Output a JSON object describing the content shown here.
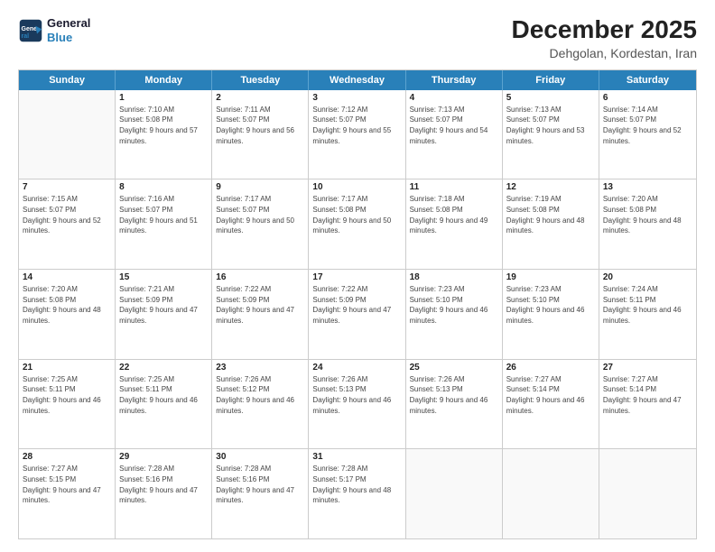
{
  "logo": {
    "line1": "General",
    "line2": "Blue"
  },
  "title": "December 2025",
  "location": "Dehgolan, Kordestan, Iran",
  "weekdays": [
    "Sunday",
    "Monday",
    "Tuesday",
    "Wednesday",
    "Thursday",
    "Friday",
    "Saturday"
  ],
  "rows": [
    [
      {
        "day": "",
        "sunrise": "",
        "sunset": "",
        "daylight": ""
      },
      {
        "day": "1",
        "sunrise": "Sunrise: 7:10 AM",
        "sunset": "Sunset: 5:08 PM",
        "daylight": "Daylight: 9 hours and 57 minutes."
      },
      {
        "day": "2",
        "sunrise": "Sunrise: 7:11 AM",
        "sunset": "Sunset: 5:07 PM",
        "daylight": "Daylight: 9 hours and 56 minutes."
      },
      {
        "day": "3",
        "sunrise": "Sunrise: 7:12 AM",
        "sunset": "Sunset: 5:07 PM",
        "daylight": "Daylight: 9 hours and 55 minutes."
      },
      {
        "day": "4",
        "sunrise": "Sunrise: 7:13 AM",
        "sunset": "Sunset: 5:07 PM",
        "daylight": "Daylight: 9 hours and 54 minutes."
      },
      {
        "day": "5",
        "sunrise": "Sunrise: 7:13 AM",
        "sunset": "Sunset: 5:07 PM",
        "daylight": "Daylight: 9 hours and 53 minutes."
      },
      {
        "day": "6",
        "sunrise": "Sunrise: 7:14 AM",
        "sunset": "Sunset: 5:07 PM",
        "daylight": "Daylight: 9 hours and 52 minutes."
      }
    ],
    [
      {
        "day": "7",
        "sunrise": "Sunrise: 7:15 AM",
        "sunset": "Sunset: 5:07 PM",
        "daylight": "Daylight: 9 hours and 52 minutes."
      },
      {
        "day": "8",
        "sunrise": "Sunrise: 7:16 AM",
        "sunset": "Sunset: 5:07 PM",
        "daylight": "Daylight: 9 hours and 51 minutes."
      },
      {
        "day": "9",
        "sunrise": "Sunrise: 7:17 AM",
        "sunset": "Sunset: 5:07 PM",
        "daylight": "Daylight: 9 hours and 50 minutes."
      },
      {
        "day": "10",
        "sunrise": "Sunrise: 7:17 AM",
        "sunset": "Sunset: 5:08 PM",
        "daylight": "Daylight: 9 hours and 50 minutes."
      },
      {
        "day": "11",
        "sunrise": "Sunrise: 7:18 AM",
        "sunset": "Sunset: 5:08 PM",
        "daylight": "Daylight: 9 hours and 49 minutes."
      },
      {
        "day": "12",
        "sunrise": "Sunrise: 7:19 AM",
        "sunset": "Sunset: 5:08 PM",
        "daylight": "Daylight: 9 hours and 48 minutes."
      },
      {
        "day": "13",
        "sunrise": "Sunrise: 7:20 AM",
        "sunset": "Sunset: 5:08 PM",
        "daylight": "Daylight: 9 hours and 48 minutes."
      }
    ],
    [
      {
        "day": "14",
        "sunrise": "Sunrise: 7:20 AM",
        "sunset": "Sunset: 5:08 PM",
        "daylight": "Daylight: 9 hours and 48 minutes."
      },
      {
        "day": "15",
        "sunrise": "Sunrise: 7:21 AM",
        "sunset": "Sunset: 5:09 PM",
        "daylight": "Daylight: 9 hours and 47 minutes."
      },
      {
        "day": "16",
        "sunrise": "Sunrise: 7:22 AM",
        "sunset": "Sunset: 5:09 PM",
        "daylight": "Daylight: 9 hours and 47 minutes."
      },
      {
        "day": "17",
        "sunrise": "Sunrise: 7:22 AM",
        "sunset": "Sunset: 5:09 PM",
        "daylight": "Daylight: 9 hours and 47 minutes."
      },
      {
        "day": "18",
        "sunrise": "Sunrise: 7:23 AM",
        "sunset": "Sunset: 5:10 PM",
        "daylight": "Daylight: 9 hours and 46 minutes."
      },
      {
        "day": "19",
        "sunrise": "Sunrise: 7:23 AM",
        "sunset": "Sunset: 5:10 PM",
        "daylight": "Daylight: 9 hours and 46 minutes."
      },
      {
        "day": "20",
        "sunrise": "Sunrise: 7:24 AM",
        "sunset": "Sunset: 5:11 PM",
        "daylight": "Daylight: 9 hours and 46 minutes."
      }
    ],
    [
      {
        "day": "21",
        "sunrise": "Sunrise: 7:25 AM",
        "sunset": "Sunset: 5:11 PM",
        "daylight": "Daylight: 9 hours and 46 minutes."
      },
      {
        "day": "22",
        "sunrise": "Sunrise: 7:25 AM",
        "sunset": "Sunset: 5:11 PM",
        "daylight": "Daylight: 9 hours and 46 minutes."
      },
      {
        "day": "23",
        "sunrise": "Sunrise: 7:26 AM",
        "sunset": "Sunset: 5:12 PM",
        "daylight": "Daylight: 9 hours and 46 minutes."
      },
      {
        "day": "24",
        "sunrise": "Sunrise: 7:26 AM",
        "sunset": "Sunset: 5:13 PM",
        "daylight": "Daylight: 9 hours and 46 minutes."
      },
      {
        "day": "25",
        "sunrise": "Sunrise: 7:26 AM",
        "sunset": "Sunset: 5:13 PM",
        "daylight": "Daylight: 9 hours and 46 minutes."
      },
      {
        "day": "26",
        "sunrise": "Sunrise: 7:27 AM",
        "sunset": "Sunset: 5:14 PM",
        "daylight": "Daylight: 9 hours and 46 minutes."
      },
      {
        "day": "27",
        "sunrise": "Sunrise: 7:27 AM",
        "sunset": "Sunset: 5:14 PM",
        "daylight": "Daylight: 9 hours and 47 minutes."
      }
    ],
    [
      {
        "day": "28",
        "sunrise": "Sunrise: 7:27 AM",
        "sunset": "Sunset: 5:15 PM",
        "daylight": "Daylight: 9 hours and 47 minutes."
      },
      {
        "day": "29",
        "sunrise": "Sunrise: 7:28 AM",
        "sunset": "Sunset: 5:16 PM",
        "daylight": "Daylight: 9 hours and 47 minutes."
      },
      {
        "day": "30",
        "sunrise": "Sunrise: 7:28 AM",
        "sunset": "Sunset: 5:16 PM",
        "daylight": "Daylight: 9 hours and 47 minutes."
      },
      {
        "day": "31",
        "sunrise": "Sunrise: 7:28 AM",
        "sunset": "Sunset: 5:17 PM",
        "daylight": "Daylight: 9 hours and 48 minutes."
      },
      {
        "day": "",
        "sunrise": "",
        "sunset": "",
        "daylight": ""
      },
      {
        "day": "",
        "sunrise": "",
        "sunset": "",
        "daylight": ""
      },
      {
        "day": "",
        "sunrise": "",
        "sunset": "",
        "daylight": ""
      }
    ]
  ]
}
